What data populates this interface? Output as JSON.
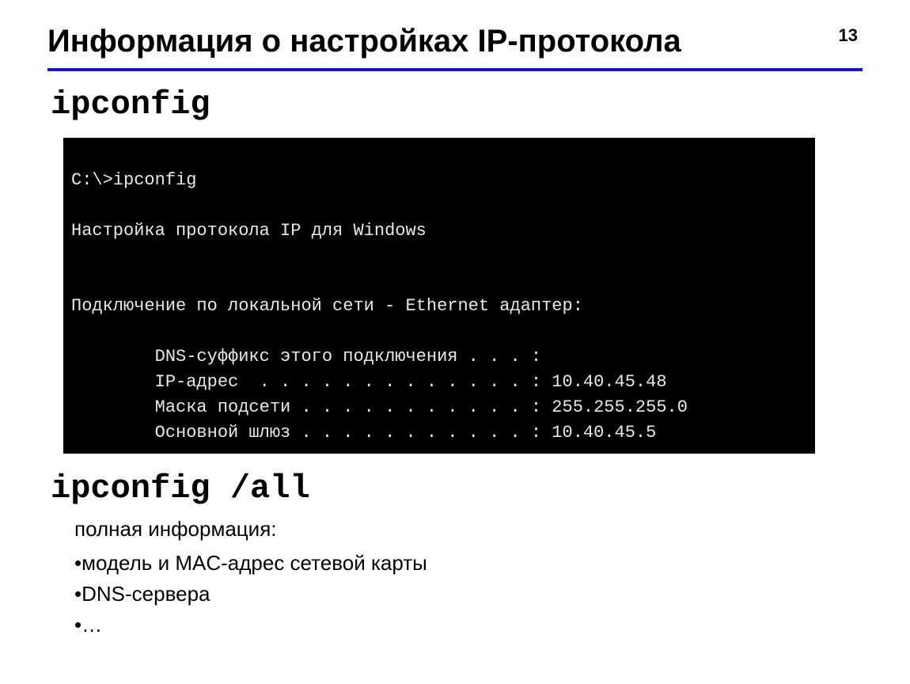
{
  "page_number": "13",
  "title": "Информация о настройках IP-протокола",
  "command1": "ipconfig",
  "terminal": {
    "prompt_line": "C:\\>ipconfig",
    "header_line": "Настройка протокола IP для Windows",
    "adapter_line": "Подключение по локальной сети - Ethernet адаптер:",
    "detail_lines": [
      "        DNS-суффикс этого подключения . . . :",
      "        IP-адрес  . . . . . . . . . . . . . : 10.40.45.48",
      "        Маска подсети . . . . . . . . . . . : 255.255.255.0",
      "        Основной шлюз . . . . . . . . . . . : 10.40.45.5"
    ]
  },
  "command2": "ipconfig /all",
  "info_header": "полная информация:",
  "bullets": [
    "модель и MAC-адрес сетевой карты",
    "DNS-сервера",
    "…"
  ]
}
